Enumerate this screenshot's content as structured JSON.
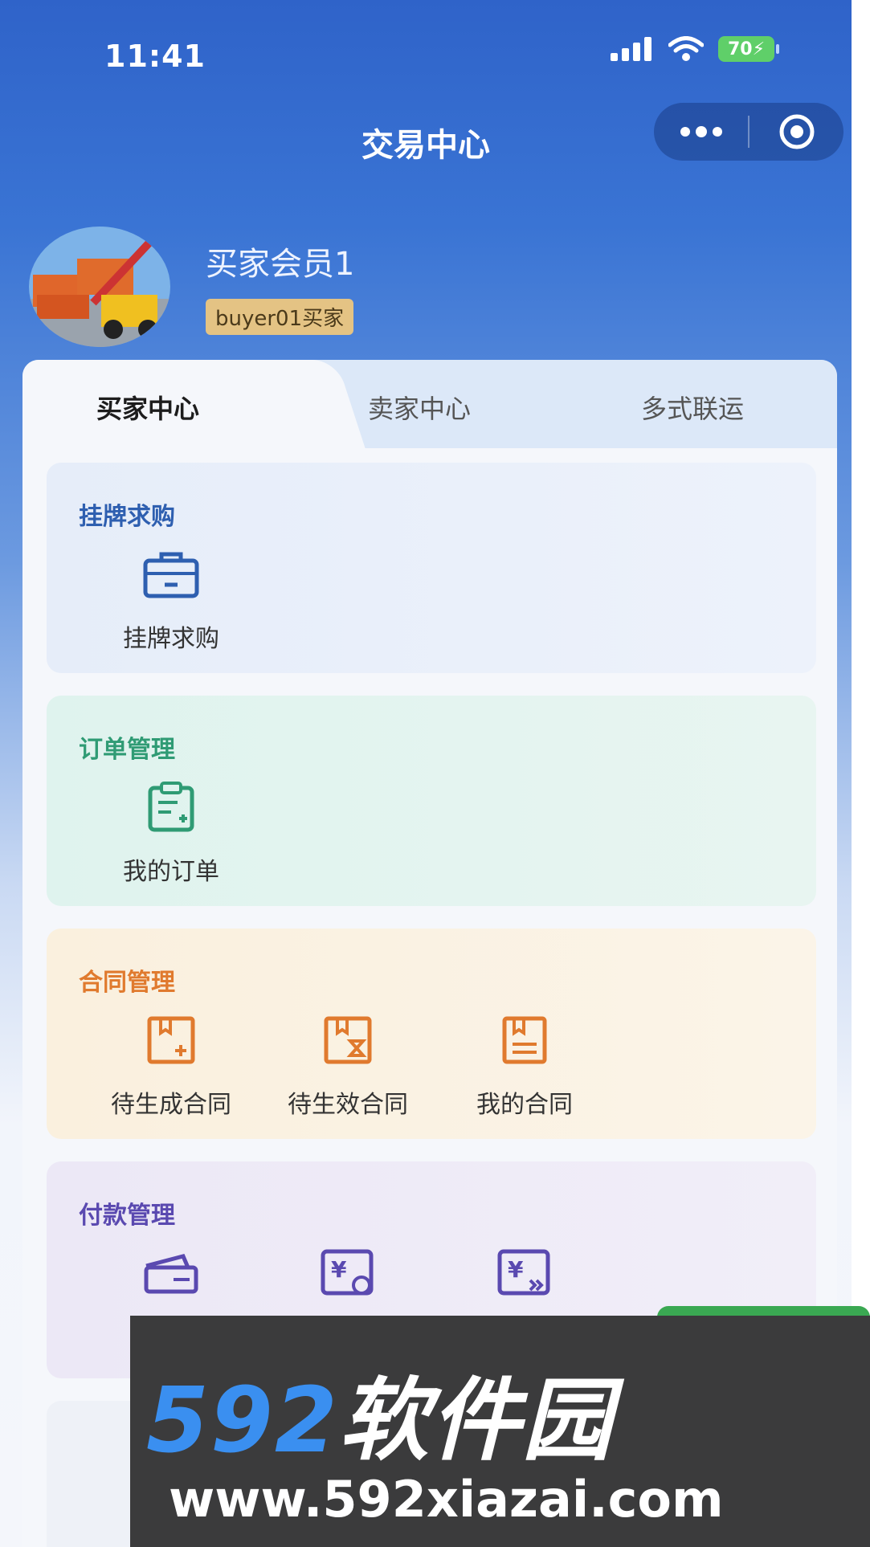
{
  "status_bar": {
    "time": "11:41",
    "battery": "70"
  },
  "header": {
    "title": "交易中心"
  },
  "profile": {
    "name": "买家会员1",
    "badge": "buyer01买家"
  },
  "tabs": [
    {
      "label": "买家中心",
      "active": true
    },
    {
      "label": "卖家中心",
      "active": false
    },
    {
      "label": "多式联运",
      "active": false
    }
  ],
  "sections": [
    {
      "title": "挂牌求购",
      "color": "#2e5fb0",
      "items": [
        {
          "label": "挂牌求购",
          "icon": "briefcase-icon"
        }
      ]
    },
    {
      "title": "订单管理",
      "color": "#2f9b74",
      "items": [
        {
          "label": "我的订单",
          "icon": "clipboard-add-icon"
        }
      ]
    },
    {
      "title": "合同管理",
      "color": "#e07a2e",
      "items": [
        {
          "label": "待生成合同",
          "icon": "contract-add-icon"
        },
        {
          "label": "待生效合同",
          "icon": "contract-hourglass-icon"
        },
        {
          "label": "我的合同",
          "icon": "contract-doc-icon"
        }
      ]
    },
    {
      "title": "付款管理",
      "color": "#5a49b0",
      "items": [
        {
          "label": "",
          "icon": "payment-card-icon"
        },
        {
          "label": "",
          "icon": "yuan-chat-icon"
        },
        {
          "label": "",
          "icon": "yuan-forward-icon"
        }
      ]
    }
  ],
  "watermark": {
    "brand_num": "592",
    "brand_text": "软件园",
    "url": "www.592xiazai.com"
  },
  "colors": {
    "header_blue": "#2f63c9",
    "badge": "#e4c384"
  }
}
